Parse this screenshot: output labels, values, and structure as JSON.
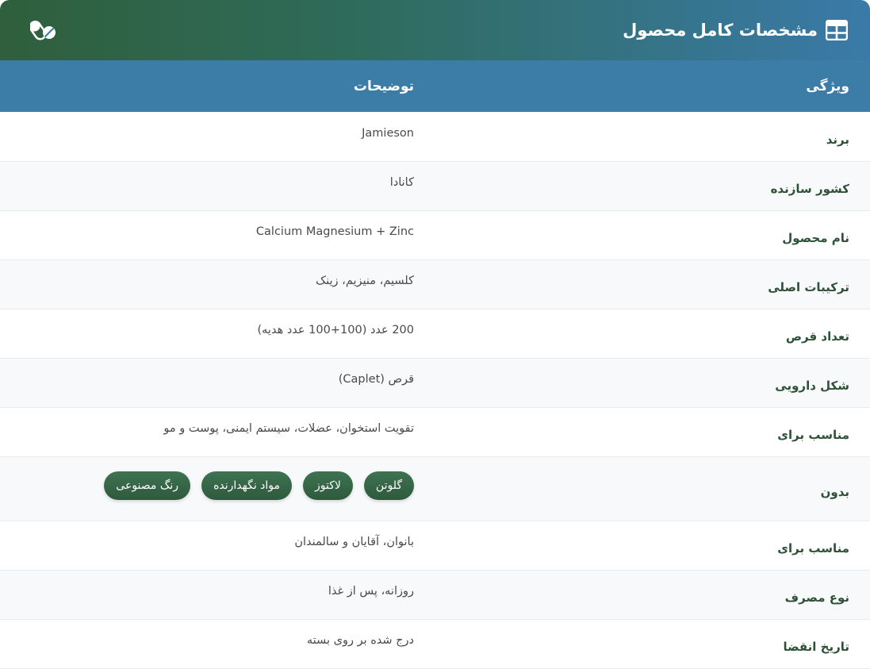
{
  "header": {
    "title": "مشخصات کامل محصول",
    "title_icon": "table-icon",
    "side_icon": "pills-icon"
  },
  "table": {
    "columns": [
      "ویژگی",
      "توضیحات"
    ],
    "rows": [
      {
        "key": "برند",
        "value": "Jamieson"
      },
      {
        "key": "کشور سازنده",
        "value": "کانادا"
      },
      {
        "key": "نام محصول",
        "value": "Calcium Magnesium + Zinc"
      },
      {
        "key": "ترکیبات اصلی",
        "value": "کلسیم، منیزیم، زینک"
      },
      {
        "key": "تعداد قرص",
        "value": "200 عدد (100+100 عدد هدیه)"
      },
      {
        "key": "شکل دارویی",
        "value": "قرص (Caplet)"
      },
      {
        "key": "مناسب برای",
        "value": "تقویت استخوان، عضلات، سیستم ایمنی، پوست و مو"
      },
      {
        "key": "بدون",
        "chips": [
          "گلوتن",
          "لاکتوز",
          "مواد نگهدارنده",
          "رنگ مصنوعی"
        ]
      },
      {
        "key": "مناسب برای",
        "value": "بانوان، آقایان و سالمندان"
      },
      {
        "key": "نوع مصرف",
        "value": "روزانه، پس از غذا"
      },
      {
        "key": "تاریخ انقضا",
        "value": "درج شده بر روی بسته"
      }
    ]
  },
  "colors": {
    "header_gradient_start": "#2f5f3c",
    "header_gradient_end": "#3a7aa8",
    "table_head": "#3c7da8",
    "key_text": "#2e5235",
    "chip": "#2e5a3c"
  }
}
